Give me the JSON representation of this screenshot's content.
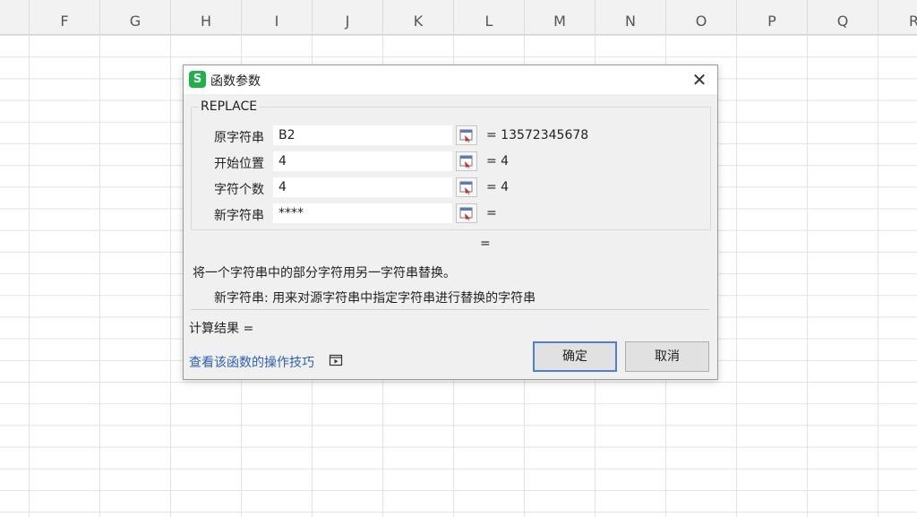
{
  "sheet": {
    "columns": [
      "F",
      "G",
      "H",
      "I",
      "J",
      "K",
      "L",
      "M",
      "N",
      "O",
      "P",
      "Q",
      "R"
    ]
  },
  "dialog": {
    "app_icon": "S",
    "title": "函数参数",
    "close_icon": "close-icon",
    "function_name": "REPLACE",
    "params": [
      {
        "label": "原字符串",
        "value": "B2",
        "result": "= 13572345678"
      },
      {
        "label": "开始位置",
        "value": "4",
        "result": "= 4"
      },
      {
        "label": "字符个数",
        "value": "4",
        "result": "= 4"
      },
      {
        "label": "新字符串",
        "value": "****",
        "result": "="
      }
    ],
    "overall_result": "=",
    "description": "将一个字符串中的部分字符用另一字符串替换。",
    "param_description": "新字符串:  用来对源字符串中指定字符串进行替换的字符串",
    "calc_result": "计算结果 =",
    "help_link": "查看该函数的操作技巧",
    "ok_label": "确定",
    "cancel_label": "取消"
  }
}
